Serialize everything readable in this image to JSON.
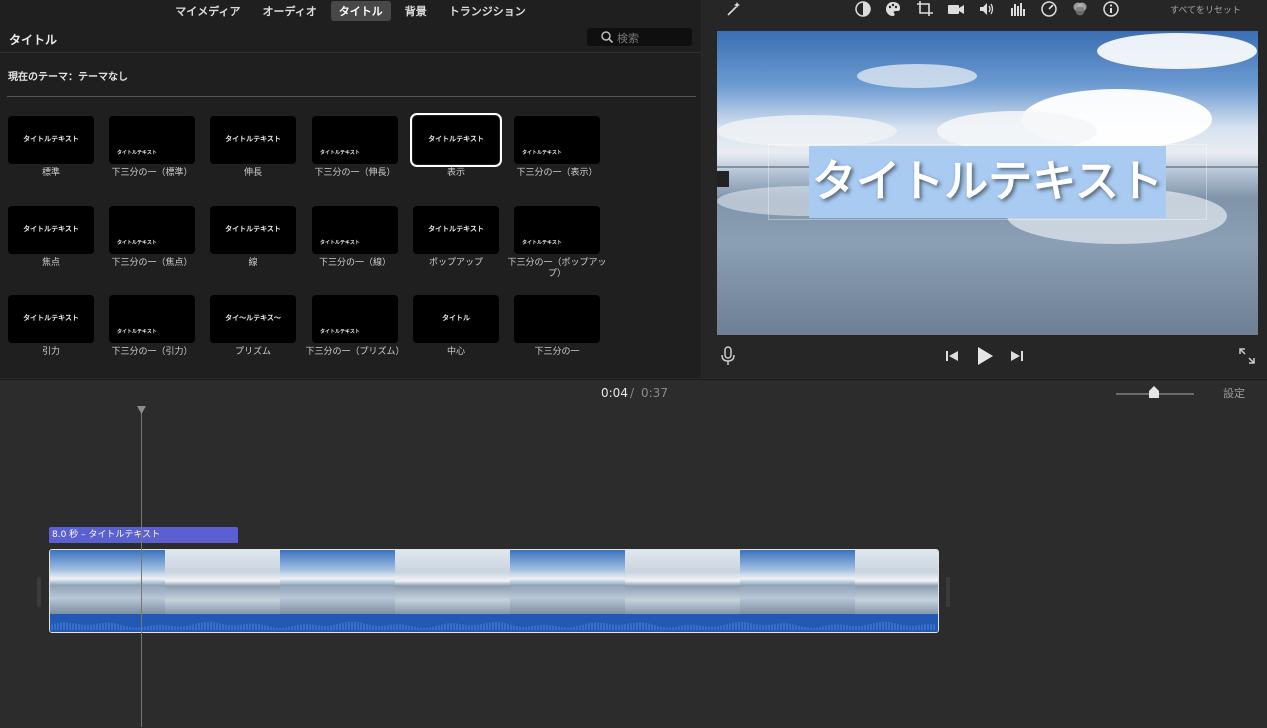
{
  "media_tabs": [
    {
      "label": "マイメディア",
      "active": false
    },
    {
      "label": "オーディオ",
      "active": false
    },
    {
      "label": "タイトル",
      "active": true
    },
    {
      "label": "背景",
      "active": false
    },
    {
      "label": "トランジション",
      "active": false
    }
  ],
  "browser": {
    "title": "タイトル",
    "search_placeholder": "検索",
    "theme_label": "現在のテーマ：テーマなし"
  },
  "titles": [
    {
      "caption": "標準",
      "preview": "タイトルテキスト",
      "selected": false
    },
    {
      "caption": "下三分の一（標準）",
      "preview": "タイトルテキスト",
      "selected": false
    },
    {
      "caption": "伸長",
      "preview": "タイトルテキスト",
      "selected": false
    },
    {
      "caption": "下三分の一（伸長）",
      "preview": "タイトルテキスト",
      "selected": false
    },
    {
      "caption": "表示",
      "preview": "タイトルテキスト",
      "selected": true
    },
    {
      "caption": "下三分の一（表示）",
      "preview": "タイトルテキスト",
      "selected": false
    },
    {
      "caption": "焦点",
      "preview": "タイトルテキスト",
      "selected": false
    },
    {
      "caption": "下三分の一（焦点）",
      "preview": "タイトルテキスト",
      "selected": false
    },
    {
      "caption": "線",
      "preview": "タイトルテキスト",
      "selected": false
    },
    {
      "caption": "下三分の一（線）",
      "preview": "タイトルテキスト",
      "selected": false
    },
    {
      "caption": "ポップアップ",
      "preview": "タイトルテキスト",
      "selected": false
    },
    {
      "caption": "下三分の一（ポップアップ）",
      "preview": "タイトルテキスト",
      "selected": false
    },
    {
      "caption": "引力",
      "preview": "タイトルテキスト",
      "selected": false
    },
    {
      "caption": "下三分の一（引力）",
      "preview": "タイトルテキスト",
      "selected": false
    },
    {
      "caption": "プリズム",
      "preview": "タイ～ルテキス～",
      "selected": false
    },
    {
      "caption": "下三分の一（プリズム）",
      "preview": "タイトルテキスト",
      "selected": false
    },
    {
      "caption": "中心",
      "preview": "タイトル",
      "selected": false
    },
    {
      "caption": "下三分の一",
      "preview": "",
      "selected": false
    }
  ],
  "viewer": {
    "reset_all": "すべてをリセット",
    "toolbar_icons": [
      "magic-wand-icon",
      "color-balance-icon",
      "color-palette-icon",
      "crop-icon",
      "stabilization-icon",
      "volume-icon",
      "equalizer-icon",
      "speed-icon",
      "clip-filter-icon",
      "info-icon"
    ],
    "overlay_title": "タイトルテキスト"
  },
  "timeline": {
    "current_time": "0:04",
    "separator": "/",
    "total_time": "0:37",
    "settings_label": "設定",
    "zoom_level": 0.45,
    "title_clip_label": "8.0 秒 – タイトルテキスト"
  },
  "colors": {
    "accent_title_clip": "#5b5fd1",
    "audio_wave": "#2358b4"
  }
}
